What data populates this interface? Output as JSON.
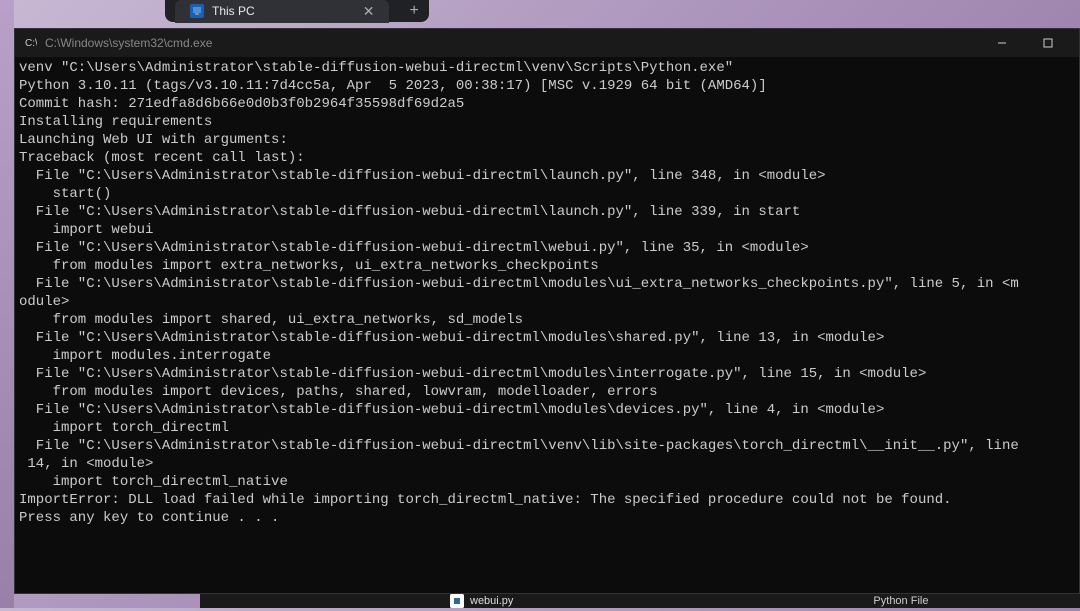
{
  "browser": {
    "tab_title": "This PC",
    "tab_close": "✕",
    "new_tab": "+"
  },
  "terminal": {
    "title_prefix": "C:\\Windows\\system32\\cm",
    "title_suffix": "d.exe",
    "title": "C:\\Windows\\system32\\cmd.exe",
    "minimize": "—",
    "maximize": "▢",
    "lines": [
      "venv \"C:\\Users\\Administrator\\stable-diffusion-webui-directml\\venv\\Scripts\\Python.exe\"",
      "Python 3.10.11 (tags/v3.10.11:7d4cc5a, Apr  5 2023, 00:38:17) [MSC v.1929 64 bit (AMD64)]",
      "Commit hash: 271edfa8d6b66e0d0b3f0b2964f35598df69d2a5",
      "Installing requirements",
      "Launching Web UI with arguments:",
      "Traceback (most recent call last):",
      "  File \"C:\\Users\\Administrator\\stable-diffusion-webui-directml\\launch.py\", line 348, in <module>",
      "    start()",
      "  File \"C:\\Users\\Administrator\\stable-diffusion-webui-directml\\launch.py\", line 339, in start",
      "    import webui",
      "  File \"C:\\Users\\Administrator\\stable-diffusion-webui-directml\\webui.py\", line 35, in <module>",
      "    from modules import extra_networks, ui_extra_networks_checkpoints",
      "  File \"C:\\Users\\Administrator\\stable-diffusion-webui-directml\\modules\\ui_extra_networks_checkpoints.py\", line 5, in <m",
      "odule>",
      "    from modules import shared, ui_extra_networks, sd_models",
      "  File \"C:\\Users\\Administrator\\stable-diffusion-webui-directml\\modules\\shared.py\", line 13, in <module>",
      "    import modules.interrogate",
      "  File \"C:\\Users\\Administrator\\stable-diffusion-webui-directml\\modules\\interrogate.py\", line 15, in <module>",
      "    from modules import devices, paths, shared, lowvram, modelloader, errors",
      "  File \"C:\\Users\\Administrator\\stable-diffusion-webui-directml\\modules\\devices.py\", line 4, in <module>",
      "    import torch_directml",
      "  File \"C:\\Users\\Administrator\\stable-diffusion-webui-directml\\venv\\lib\\site-packages\\torch_directml\\__init__.py\", line",
      " 14, in <module>",
      "    import torch_directml_native",
      "ImportError: DLL load failed while importing torch_directml_native: The specified procedure could not be found.",
      "Press any key to continue . . ."
    ]
  },
  "bottom": {
    "filename": "webui.py",
    "filetype": "Python File"
  }
}
